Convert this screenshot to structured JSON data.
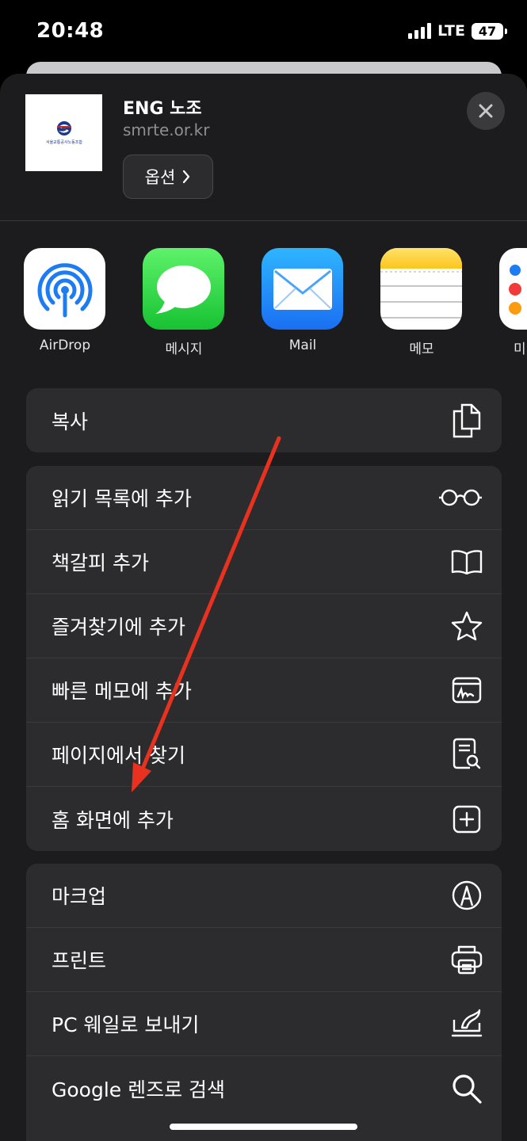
{
  "status_bar": {
    "time": "20:48",
    "network": "LTE",
    "battery": "47"
  },
  "header": {
    "title": "ENG 노조",
    "url": "smrte.or.kr",
    "options_label": "옵션",
    "logo_caption": "서울교통공사노동조합"
  },
  "apps": [
    {
      "label": "AirDrop",
      "icon": "airdrop-icon"
    },
    {
      "label": "메시지",
      "icon": "messages-icon"
    },
    {
      "label": "Mail",
      "icon": "mail-icon"
    },
    {
      "label": "메모",
      "icon": "notes-icon"
    },
    {
      "label": "미",
      "icon": "reminders-icon"
    }
  ],
  "group1": [
    {
      "label": "복사",
      "icon": "copy-icon"
    }
  ],
  "group2": [
    {
      "label": "읽기 목록에 추가",
      "icon": "glasses-icon"
    },
    {
      "label": "책갈피 추가",
      "icon": "book-icon"
    },
    {
      "label": "즐겨찾기에 추가",
      "icon": "star-icon"
    },
    {
      "label": "빠른 메모에 추가",
      "icon": "quick-note-icon"
    },
    {
      "label": "페이지에서 찾기",
      "icon": "find-in-page-icon"
    },
    {
      "label": "홈 화면에 추가",
      "icon": "add-square-icon"
    }
  ],
  "group3": [
    {
      "label": "마크업",
      "icon": "markup-icon"
    },
    {
      "label": "프린트",
      "icon": "printer-icon"
    },
    {
      "label": "PC 웨일로 보내기",
      "icon": "send-to-pc-icon"
    },
    {
      "label": "Google 렌즈로 검색",
      "icon": "search-icon"
    }
  ],
  "colors": {
    "accent_arrow": "#e8321f",
    "sheet_bg": "#1c1c1e",
    "row_bg": "#2c2c2e"
  }
}
